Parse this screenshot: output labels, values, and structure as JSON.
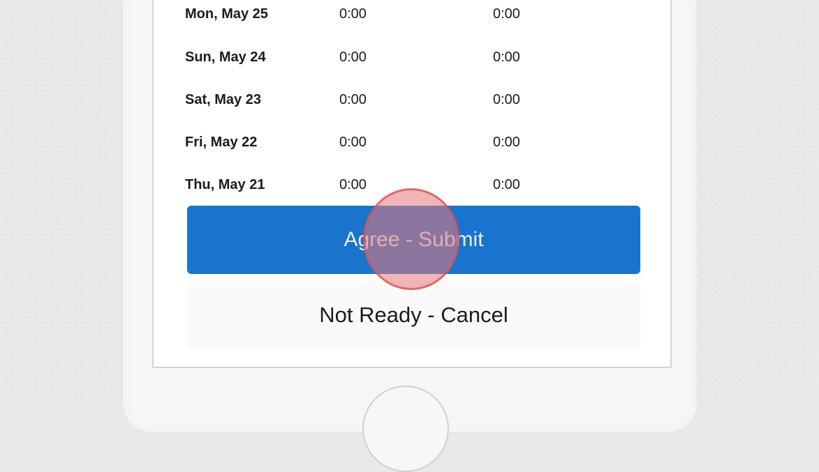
{
  "timesheet": {
    "rows": [
      {
        "date": "Mon, May 25",
        "time_a": "0:00",
        "time_b": "0:00"
      },
      {
        "date": "Sun, May 24",
        "time_a": "0:00",
        "time_b": "0:00"
      },
      {
        "date": "Sat, May 23",
        "time_a": "0:00",
        "time_b": "0:00"
      },
      {
        "date": "Fri, May 22",
        "time_a": "0:00",
        "time_b": "0:00"
      },
      {
        "date": "Thu, May 21",
        "time_a": "0:00",
        "time_b": "0:00"
      }
    ]
  },
  "actions": {
    "submit_label": "Agree - Submit",
    "cancel_label": "Not Ready - Cancel"
  },
  "colors": {
    "submit_background": "#1a73cc",
    "tap_indicator": "#e87878"
  }
}
